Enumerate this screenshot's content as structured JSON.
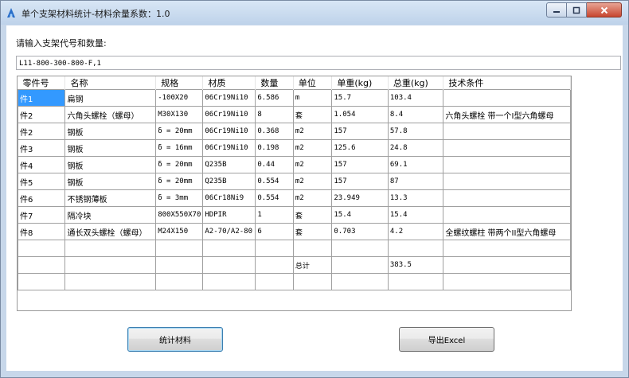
{
  "window": {
    "title": "单个支架材料统计-材料余量系数：1.0"
  },
  "form": {
    "prompt": "请输入支架代号和数量:",
    "input_value": "L11-800-300-800-F,1"
  },
  "table": {
    "columns": [
      "零件号",
      "名称",
      "规格",
      "材质",
      "数量",
      "单位",
      "单重(kg)",
      "总重(kg)",
      "技术条件"
    ],
    "rows": [
      [
        "件1",
        "扁钢",
        "-100X20",
        "06Cr19Ni10",
        "6.586",
        "m",
        "15.7",
        "103.4",
        ""
      ],
      [
        "件2",
        "六角头螺栓（螺母）",
        "M30X130",
        "06Cr19Ni10",
        "8",
        "套",
        "1.054",
        "8.4",
        "六角头螺栓 带一个I型六角螺母"
      ],
      [
        "件2",
        "钢板",
        "δ = 20mm",
        "06Cr19Ni10",
        "0.368",
        "m2",
        "157",
        "57.8",
        ""
      ],
      [
        "件3",
        "钢板",
        "δ = 16mm",
        "06Cr19Ni10",
        "0.198",
        "m2",
        "125.6",
        "24.8",
        ""
      ],
      [
        "件4",
        "钢板",
        "δ = 20mm",
        "Q235B",
        "0.44",
        "m2",
        "157",
        "69.1",
        ""
      ],
      [
        "件5",
        "钢板",
        "δ = 20mm",
        "Q235B",
        "0.554",
        "m2",
        "157",
        "87",
        ""
      ],
      [
        "件6",
        "不锈钢薄板",
        "δ = 3mm",
        "06Cr18Ni9",
        "0.554",
        "m2",
        "23.949",
        "13.3",
        ""
      ],
      [
        "件7",
        "隔冷块",
        "800X550X70",
        "HDPIR",
        "1",
        "套",
        "15.4",
        "15.4",
        ""
      ],
      [
        "件8",
        "通长双头螺栓（螺母）",
        "M24X150",
        "A2-70/A2-80",
        "6",
        "套",
        "0.703",
        "4.2",
        "全螺纹螺柱 带两个II型六角螺母"
      ],
      [
        "",
        "",
        "",
        "",
        "",
        "",
        "",
        "",
        ""
      ],
      [
        "",
        "",
        "",
        "",
        "",
        "总计",
        "",
        "383.5",
        ""
      ],
      [
        "",
        "",
        "",
        "",
        "",
        "",
        "",
        "",
        ""
      ]
    ]
  },
  "buttons": {
    "stats": "统计材料",
    "export": "导出Excel"
  },
  "colors": {
    "selection": "#3399ff"
  }
}
